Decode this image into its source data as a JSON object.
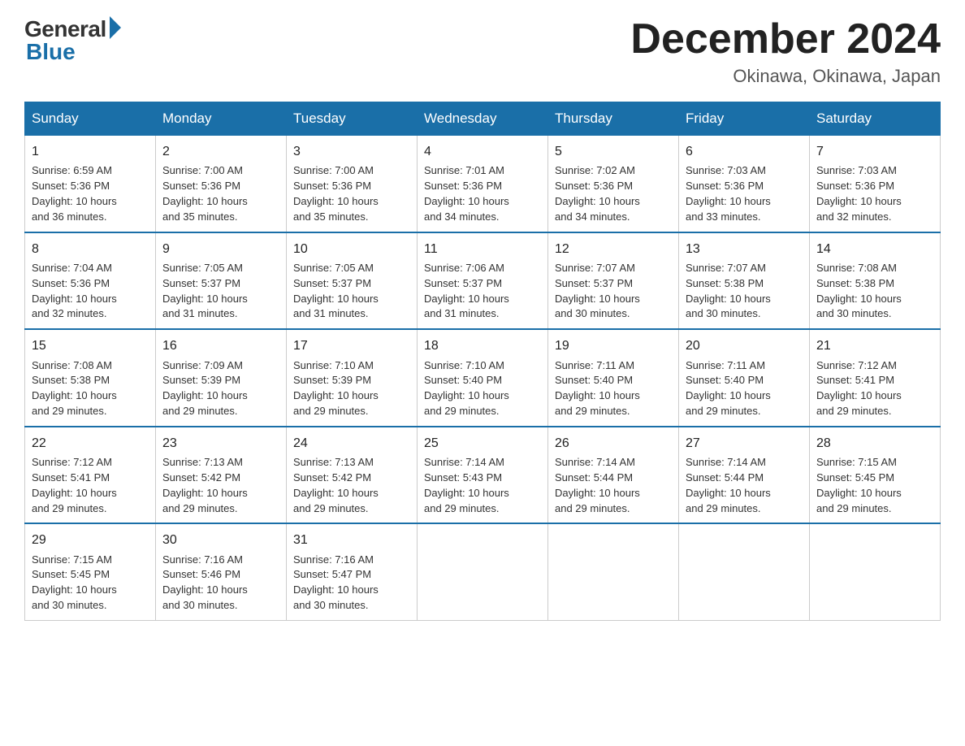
{
  "logo": {
    "general": "General",
    "blue": "Blue"
  },
  "title": "December 2024",
  "location": "Okinawa, Okinawa, Japan",
  "days_of_week": [
    "Sunday",
    "Monday",
    "Tuesday",
    "Wednesday",
    "Thursday",
    "Friday",
    "Saturday"
  ],
  "weeks": [
    [
      {
        "day": 1,
        "sunrise": "6:59 AM",
        "sunset": "5:36 PM",
        "daylight": "10 hours and 36 minutes."
      },
      {
        "day": 2,
        "sunrise": "7:00 AM",
        "sunset": "5:36 PM",
        "daylight": "10 hours and 35 minutes."
      },
      {
        "day": 3,
        "sunrise": "7:00 AM",
        "sunset": "5:36 PM",
        "daylight": "10 hours and 35 minutes."
      },
      {
        "day": 4,
        "sunrise": "7:01 AM",
        "sunset": "5:36 PM",
        "daylight": "10 hours and 34 minutes."
      },
      {
        "day": 5,
        "sunrise": "7:02 AM",
        "sunset": "5:36 PM",
        "daylight": "10 hours and 34 minutes."
      },
      {
        "day": 6,
        "sunrise": "7:03 AM",
        "sunset": "5:36 PM",
        "daylight": "10 hours and 33 minutes."
      },
      {
        "day": 7,
        "sunrise": "7:03 AM",
        "sunset": "5:36 PM",
        "daylight": "10 hours and 32 minutes."
      }
    ],
    [
      {
        "day": 8,
        "sunrise": "7:04 AM",
        "sunset": "5:36 PM",
        "daylight": "10 hours and 32 minutes."
      },
      {
        "day": 9,
        "sunrise": "7:05 AM",
        "sunset": "5:37 PM",
        "daylight": "10 hours and 31 minutes."
      },
      {
        "day": 10,
        "sunrise": "7:05 AM",
        "sunset": "5:37 PM",
        "daylight": "10 hours and 31 minutes."
      },
      {
        "day": 11,
        "sunrise": "7:06 AM",
        "sunset": "5:37 PM",
        "daylight": "10 hours and 31 minutes."
      },
      {
        "day": 12,
        "sunrise": "7:07 AM",
        "sunset": "5:37 PM",
        "daylight": "10 hours and 30 minutes."
      },
      {
        "day": 13,
        "sunrise": "7:07 AM",
        "sunset": "5:38 PM",
        "daylight": "10 hours and 30 minutes."
      },
      {
        "day": 14,
        "sunrise": "7:08 AM",
        "sunset": "5:38 PM",
        "daylight": "10 hours and 30 minutes."
      }
    ],
    [
      {
        "day": 15,
        "sunrise": "7:08 AM",
        "sunset": "5:38 PM",
        "daylight": "10 hours and 29 minutes."
      },
      {
        "day": 16,
        "sunrise": "7:09 AM",
        "sunset": "5:39 PM",
        "daylight": "10 hours and 29 minutes."
      },
      {
        "day": 17,
        "sunrise": "7:10 AM",
        "sunset": "5:39 PM",
        "daylight": "10 hours and 29 minutes."
      },
      {
        "day": 18,
        "sunrise": "7:10 AM",
        "sunset": "5:40 PM",
        "daylight": "10 hours and 29 minutes."
      },
      {
        "day": 19,
        "sunrise": "7:11 AM",
        "sunset": "5:40 PM",
        "daylight": "10 hours and 29 minutes."
      },
      {
        "day": 20,
        "sunrise": "7:11 AM",
        "sunset": "5:40 PM",
        "daylight": "10 hours and 29 minutes."
      },
      {
        "day": 21,
        "sunrise": "7:12 AM",
        "sunset": "5:41 PM",
        "daylight": "10 hours and 29 minutes."
      }
    ],
    [
      {
        "day": 22,
        "sunrise": "7:12 AM",
        "sunset": "5:41 PM",
        "daylight": "10 hours and 29 minutes."
      },
      {
        "day": 23,
        "sunrise": "7:13 AM",
        "sunset": "5:42 PM",
        "daylight": "10 hours and 29 minutes."
      },
      {
        "day": 24,
        "sunrise": "7:13 AM",
        "sunset": "5:42 PM",
        "daylight": "10 hours and 29 minutes."
      },
      {
        "day": 25,
        "sunrise": "7:14 AM",
        "sunset": "5:43 PM",
        "daylight": "10 hours and 29 minutes."
      },
      {
        "day": 26,
        "sunrise": "7:14 AM",
        "sunset": "5:44 PM",
        "daylight": "10 hours and 29 minutes."
      },
      {
        "day": 27,
        "sunrise": "7:14 AM",
        "sunset": "5:44 PM",
        "daylight": "10 hours and 29 minutes."
      },
      {
        "day": 28,
        "sunrise": "7:15 AM",
        "sunset": "5:45 PM",
        "daylight": "10 hours and 29 minutes."
      }
    ],
    [
      {
        "day": 29,
        "sunrise": "7:15 AM",
        "sunset": "5:45 PM",
        "daylight": "10 hours and 30 minutes."
      },
      {
        "day": 30,
        "sunrise": "7:16 AM",
        "sunset": "5:46 PM",
        "daylight": "10 hours and 30 minutes."
      },
      {
        "day": 31,
        "sunrise": "7:16 AM",
        "sunset": "5:47 PM",
        "daylight": "10 hours and 30 minutes."
      },
      null,
      null,
      null,
      null
    ]
  ],
  "labels": {
    "sunrise": "Sunrise:",
    "sunset": "Sunset:",
    "daylight": "Daylight:"
  }
}
